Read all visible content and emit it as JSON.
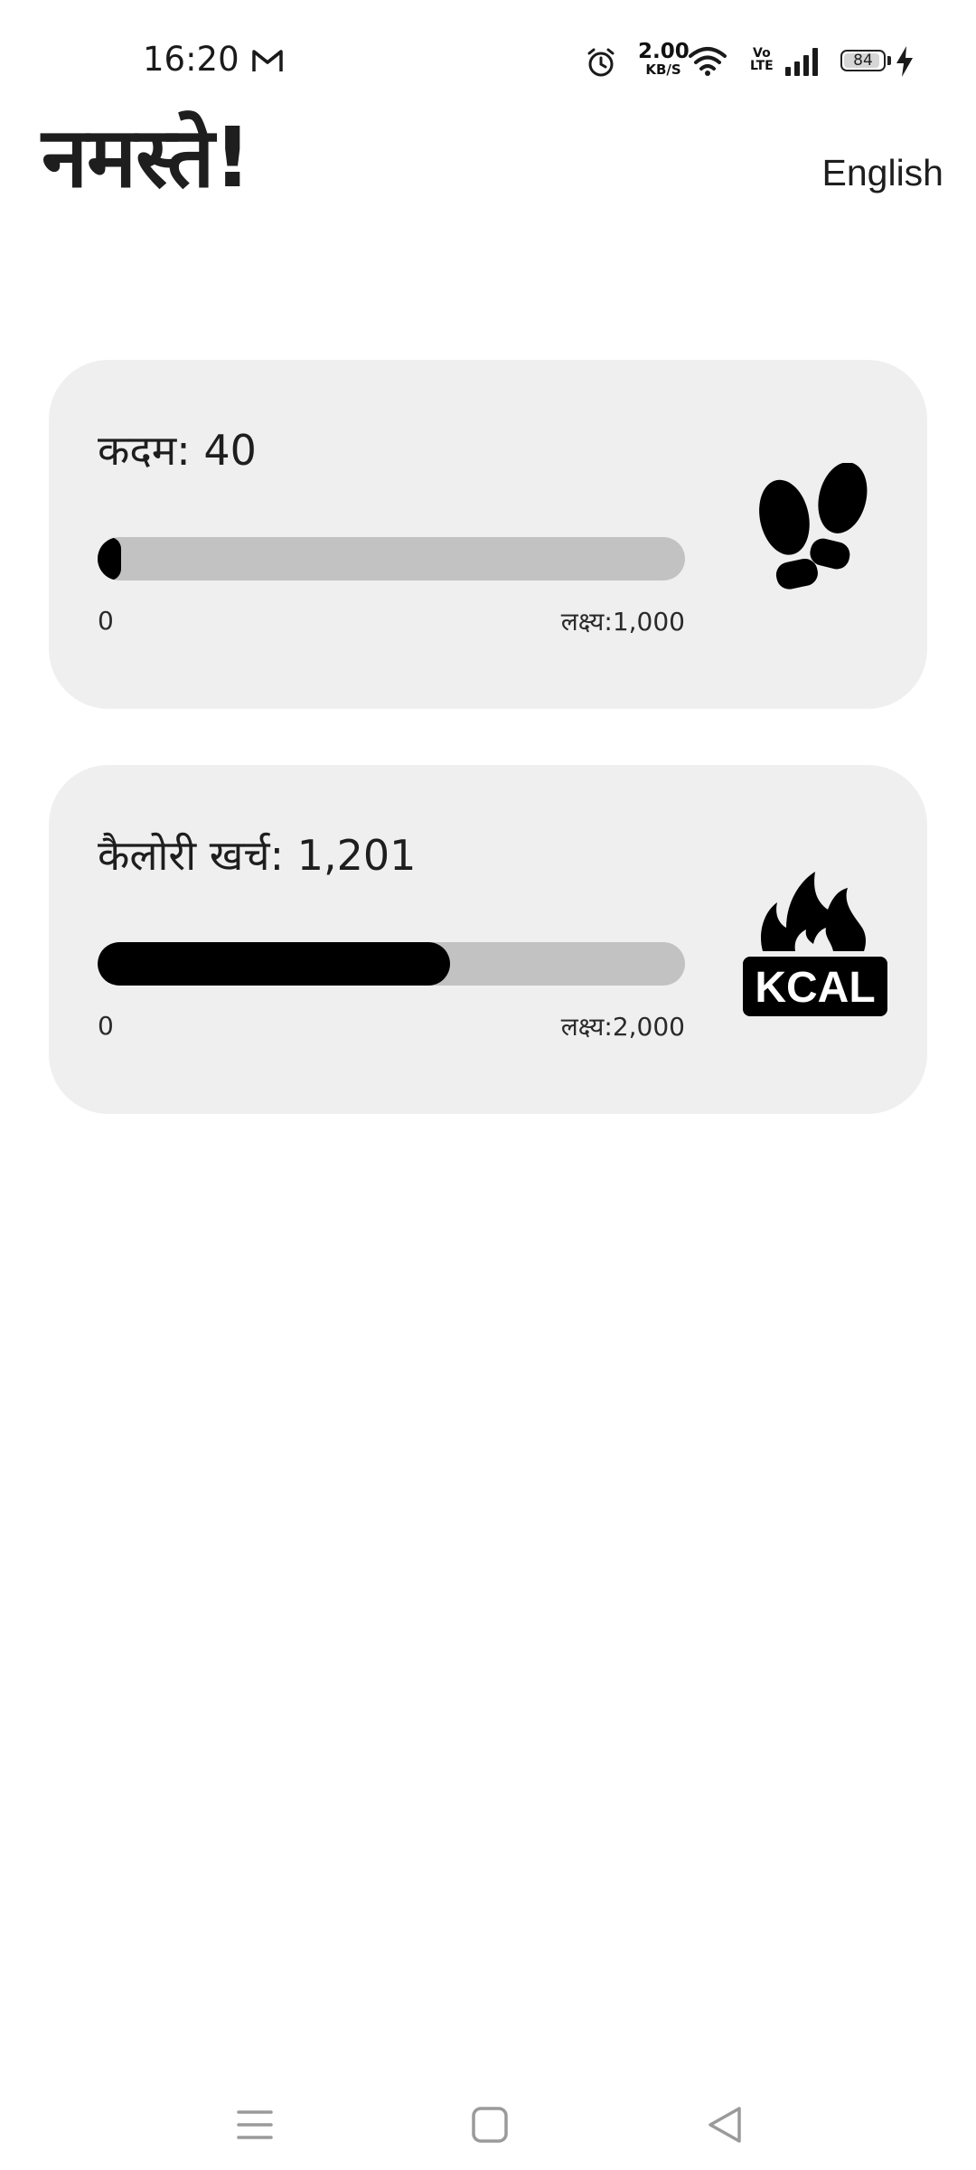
{
  "status_bar": {
    "time": "16:20",
    "net_speed_value": "2.00",
    "net_speed_unit": "KB/S",
    "volte_top": "Vo",
    "volte_bottom": "LTE",
    "battery_level": "84",
    "icons": [
      "gmail-icon",
      "alarm-icon",
      "wifi-icon",
      "signal-icon",
      "battery-icon",
      "charging-icon"
    ]
  },
  "header": {
    "greeting": "नमस्ते!",
    "language_button": "English"
  },
  "cards": {
    "steps": {
      "title": "कदम: 40",
      "current": 40,
      "goal": 1000,
      "progress_fraction": 0.04,
      "min_label": "0",
      "goal_label": "लक्ष्य:1,000",
      "icon": "footprints-icon"
    },
    "calories": {
      "title": "कैलोरी खर्च: 1,201",
      "current": 1201,
      "goal": 2000,
      "progress_fraction": 0.6,
      "min_label": "0",
      "goal_label": "लक्ष्य:2,000",
      "icon": "kcal-flame-icon",
      "icon_text": "KCAL"
    }
  },
  "nav_bar": {
    "icons": [
      "menu-icon",
      "home-icon",
      "back-icon"
    ]
  },
  "colors": {
    "card_background": "#efefef",
    "progress_track": "#c2c2c2",
    "progress_fill": "#000000",
    "text": "#1e1e1e"
  }
}
